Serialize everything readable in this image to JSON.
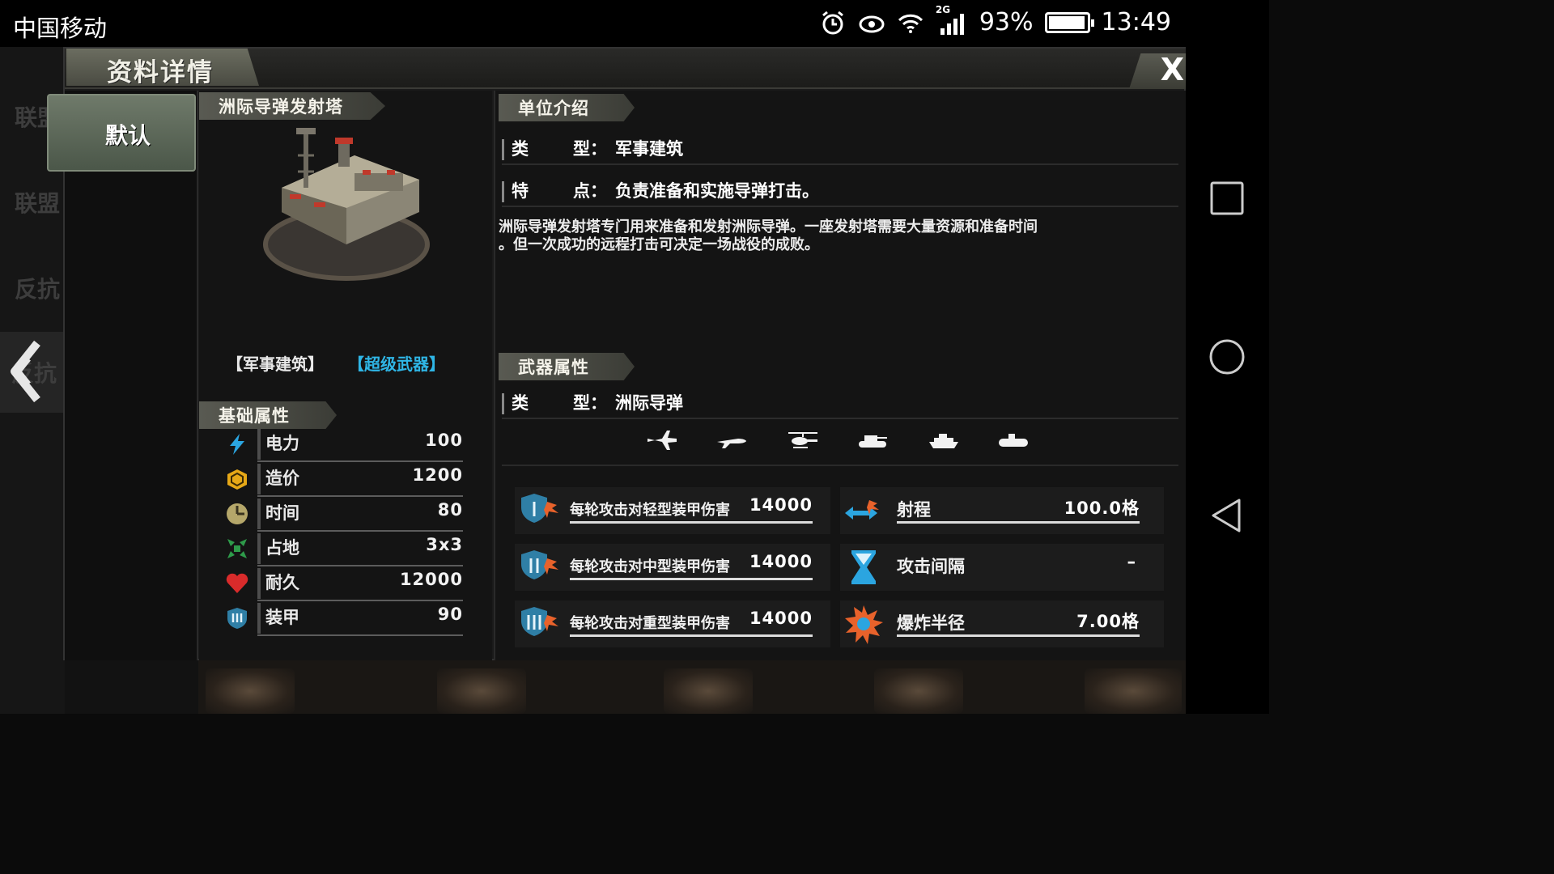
{
  "status_bar": {
    "carrier": "中国移动",
    "network": "2G",
    "battery": "93%",
    "time": "13:49"
  },
  "background_tabs": [
    "联盟",
    "联盟",
    "反抗",
    "反抗"
  ],
  "panel": {
    "title": "资料详情",
    "close_label": "X",
    "side_tab": "默认"
  },
  "unit": {
    "name": "洲际导弹发射塔",
    "tags": [
      "【军事建筑】",
      "【超级武器】"
    ],
    "tag_colors": [
      "#f0f0f0",
      "#2fb6e6"
    ]
  },
  "basic_attributes": {
    "header": "基础属性",
    "items": [
      {
        "icon": "lightning-icon",
        "label": "电力",
        "value": "100"
      },
      {
        "icon": "cube-icon",
        "label": "造价",
        "value": "1200"
      },
      {
        "icon": "clock-icon",
        "label": "时间",
        "value": "80"
      },
      {
        "icon": "expand-arrows-icon",
        "label": "占地",
        "value": "3x3"
      },
      {
        "icon": "heart-icon",
        "label": "耐久",
        "value": "12000"
      },
      {
        "icon": "armor-shield-icon",
        "label": "装甲",
        "value": "90"
      }
    ]
  },
  "unit_intro": {
    "header": "单位介绍",
    "type_key_a": "类",
    "type_key_b": "型：",
    "type_value": "军事建筑",
    "feature_key_a": "特",
    "feature_key_b": "点：",
    "feature_value": "负责准备和实施导弹打击。",
    "description_line1": "洲际导弹发射塔专门用来准备和发射洲际导弹。一座发射塔需要大量资源和准备时间",
    "description_line2": "。但一次成功的远程打击可决定一场战役的成败。"
  },
  "weapon_attributes": {
    "header": "武器属性",
    "type_key_a": "类",
    "type_key_b": "型：",
    "type_value": "洲际导弹",
    "targets": [
      "jet-fighter-icon",
      "bomber-plane-icon",
      "helicopter-icon",
      "tank-icon",
      "ship-icon",
      "submarine-icon"
    ],
    "damage": [
      {
        "icon": "light-armor-damage-icon",
        "label": "每轮攻击对轻型装甲伤害",
        "value": "14000"
      },
      {
        "icon": "medium-armor-damage-icon",
        "label": "每轮攻击对中型装甲伤害",
        "value": "14000"
      },
      {
        "icon": "heavy-armor-damage-icon",
        "label": "每轮攻击对重型装甲伤害",
        "value": "14000"
      }
    ],
    "stats": [
      {
        "icon": "range-arrows-icon",
        "label": "射程",
        "value": "100.0格"
      },
      {
        "icon": "hourglass-icon",
        "label": "攻击间隔",
        "value": "–"
      },
      {
        "icon": "explosion-icon",
        "label": "爆炸半径",
        "value": "7.00格"
      }
    ]
  }
}
